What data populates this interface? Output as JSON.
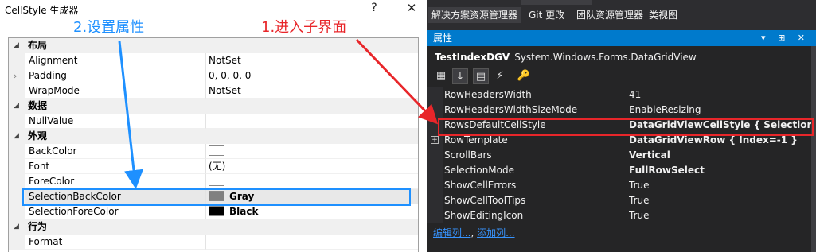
{
  "dialog": {
    "title": "CellStyle 生成器",
    "help_glyph": "?",
    "close_glyph": "✕"
  },
  "annotations": {
    "step2": "2.设置属性",
    "step1": "1.进入子界面",
    "blue": "#1e90ff",
    "red": "#e8262a"
  },
  "property_grid": {
    "categories": {
      "layout": "布局",
      "data": "数据",
      "appearance": "外观",
      "behavior": "行为"
    },
    "rows": {
      "alignment": {
        "name": "Alignment",
        "value": "NotSet"
      },
      "padding": {
        "name": "Padding",
        "value": "0, 0, 0, 0"
      },
      "wrapmode": {
        "name": "WrapMode",
        "value": "NotSet"
      },
      "nullvalue": {
        "name": "NullValue",
        "value": ""
      },
      "backcolor": {
        "name": "BackColor",
        "value": "",
        "swatch": "#ffffff"
      },
      "font": {
        "name": "Font",
        "value": "(无)"
      },
      "forecolor": {
        "name": "ForeColor",
        "value": "",
        "swatch": "#ffffff"
      },
      "selbackcolor": {
        "name": "SelectionBackColor",
        "value": "Gray",
        "swatch": "#808080"
      },
      "selforecolor": {
        "name": "SelectionForeColor",
        "value": "Black",
        "swatch": "#000000"
      },
      "format": {
        "name": "Format",
        "value": ""
      }
    }
  },
  "vs": {
    "tabs": {
      "solution": "解决方案资源管理器",
      "git": "Git 更改",
      "team": "团队资源管理器",
      "classview": "类视图"
    },
    "properties_title": "属性",
    "controls": "▾ ⊞ ✕",
    "object_name": "TestIndexDGV",
    "object_type": "System.Windows.Forms.DataGridView",
    "rows": {
      "r1": {
        "name": "RowHeadersWidth",
        "value": "41"
      },
      "r2": {
        "name": "RowHeadersWidthSizeMode",
        "value": "EnableResizing"
      },
      "r3": {
        "name": "RowsDefaultCellStyle",
        "value": "DataGridViewCellStyle { SelectionBackColor"
      },
      "r4": {
        "name": "RowTemplate",
        "value": "DataGridViewRow { Index=-1 }"
      },
      "r5": {
        "name": "ScrollBars",
        "value": "Vertical"
      },
      "r6": {
        "name": "SelectionMode",
        "value": "FullRowSelect"
      },
      "r7": {
        "name": "ShowCellErrors",
        "value": "True"
      },
      "r8": {
        "name": "ShowCellToolTips",
        "value": "True"
      },
      "r9": {
        "name": "ShowEditingIcon",
        "value": "True"
      }
    },
    "links": {
      "edit_columns": "编辑列...",
      "separator": ", ",
      "add_column": "添加列..."
    },
    "accent": "#007acc"
  }
}
